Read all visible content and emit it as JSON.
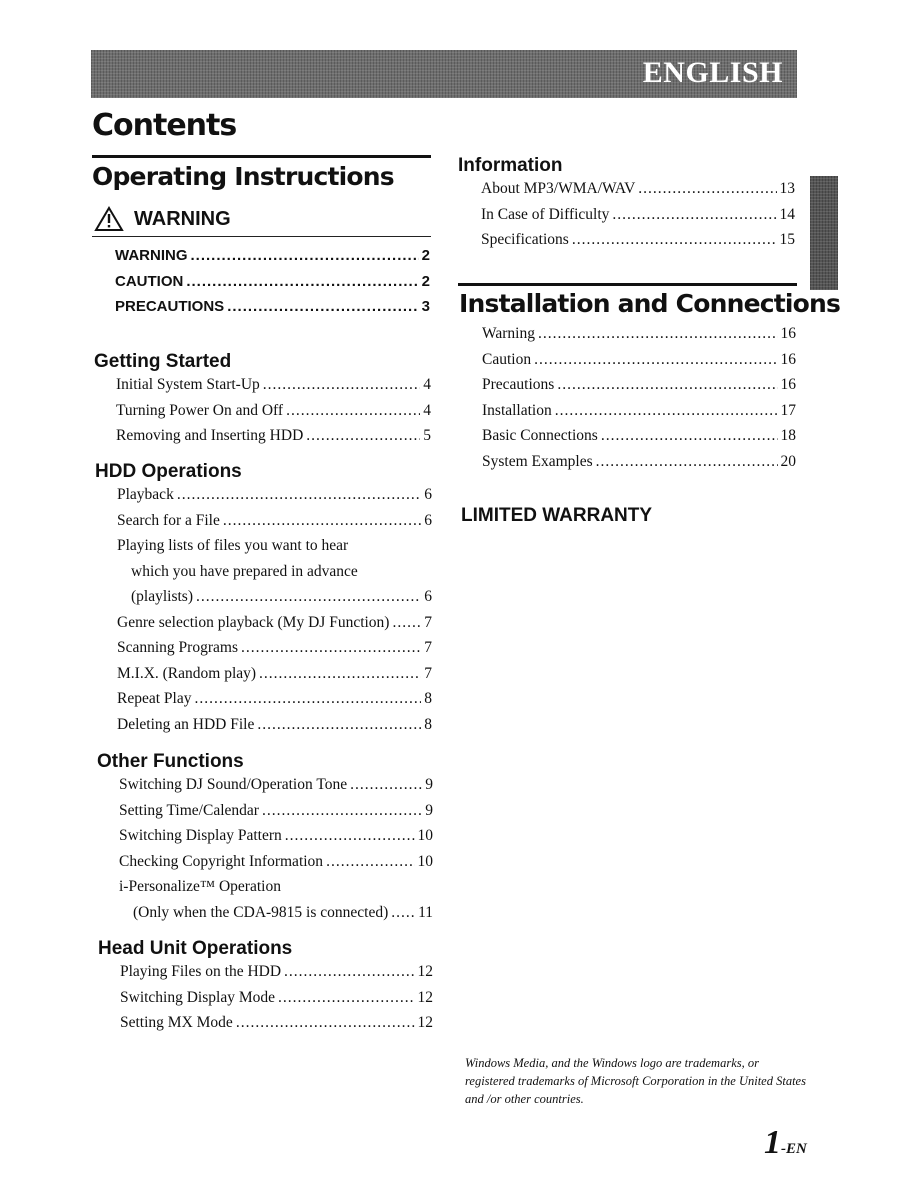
{
  "banner": {
    "language": "ENGLISH"
  },
  "title": "Contents",
  "operating_instructions": {
    "heading": "Operating Instructions",
    "warning_block": {
      "heading": "WARNING",
      "icon": "warning-triangle-icon",
      "items": [
        {
          "label": "WARNING",
          "page": "2"
        },
        {
          "label": "CAUTION",
          "page": "2"
        },
        {
          "label": "PRECAUTIONS",
          "page": "3"
        }
      ]
    },
    "getting_started": {
      "heading": "Getting Started",
      "items": [
        {
          "label": "Initial System Start-Up",
          "page": "4"
        },
        {
          "label": "Turning Power On and Off",
          "page": "4"
        },
        {
          "label": "Removing and Inserting HDD",
          "page": "5"
        }
      ]
    },
    "hdd_operations": {
      "heading": "HDD Operations",
      "items": [
        {
          "label": "Playback",
          "page": "6"
        },
        {
          "label": "Search for a File",
          "page": "6"
        },
        {
          "label": "Playing lists of files you want to hear",
          "page": ""
        },
        {
          "label": "which you have prepared in advance",
          "page": ""
        },
        {
          "label": "(playlists)",
          "page": "6"
        },
        {
          "label": "Genre selection playback (My DJ Function)",
          "page": "7"
        },
        {
          "label": "Scanning Programs",
          "page": "7"
        },
        {
          "label": "M.I.X. (Random play)",
          "page": "7"
        },
        {
          "label": "Repeat Play",
          "page": "8"
        },
        {
          "label": "Deleting an HDD File",
          "page": "8"
        }
      ]
    },
    "other_functions": {
      "heading": "Other Functions",
      "items": [
        {
          "label": "Switching DJ Sound/Operation Tone",
          "page": "9"
        },
        {
          "label": "Setting Time/Calendar",
          "page": "9"
        },
        {
          "label": "Switching Display Pattern",
          "page": "10"
        },
        {
          "label": "Checking Copyright Information",
          "page": "10"
        },
        {
          "label": "i-Personalize™ Operation",
          "page": ""
        },
        {
          "label": "(Only when the CDA-9815 is connected)",
          "page": "11"
        }
      ]
    },
    "head_unit_operations": {
      "heading": "Head Unit Operations",
      "items": [
        {
          "label": "Playing Files on the HDD",
          "page": "12"
        },
        {
          "label": "Switching Display Mode",
          "page": "12"
        },
        {
          "label": "Setting MX Mode",
          "page": "12"
        }
      ]
    }
  },
  "information": {
    "heading": "Information",
    "items": [
      {
        "label": "About MP3/WMA/WAV",
        "page": "13"
      },
      {
        "label": "In Case of Difficulty",
        "page": "14"
      },
      {
        "label": "Specifications",
        "page": "15"
      }
    ]
  },
  "installation": {
    "heading": "Installation and Connections",
    "items": [
      {
        "label": "Warning",
        "page": "16"
      },
      {
        "label": "Caution",
        "page": "16"
      },
      {
        "label": "Precautions",
        "page": "16"
      },
      {
        "label": "Installation",
        "page": "17"
      },
      {
        "label": "Basic Connections",
        "page": "18"
      },
      {
        "label": "System Examples",
        "page": "20"
      }
    ]
  },
  "limited_warranty": {
    "heading": "LIMITED WARRANTY"
  },
  "footnote": "Windows Media, and the Windows logo are trademarks, or registered trademarks of Microsoft Corporation in the United States and /or other countries.",
  "page_number": {
    "number": "1",
    "suffix": "-EN"
  }
}
